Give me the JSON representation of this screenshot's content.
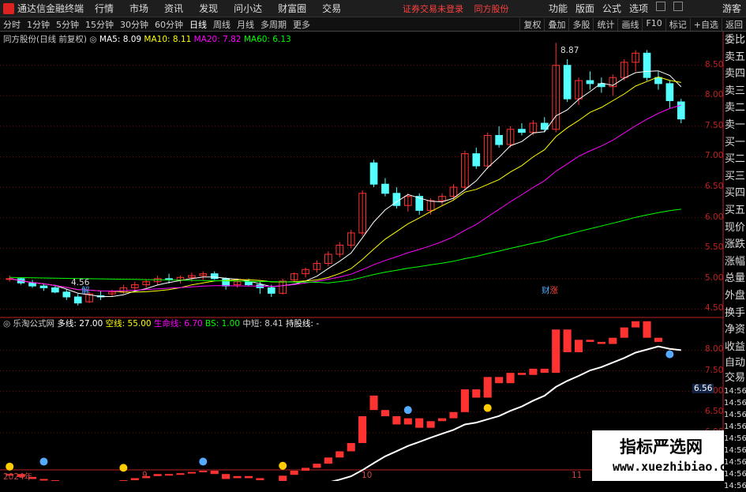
{
  "app": {
    "title": "通达信金融终端",
    "menus": [
      "行情",
      "市场",
      "资讯",
      "发现",
      "问小达",
      "财富圈",
      "交易"
    ],
    "warning": "证券交易未登录",
    "stock_label": "同方股份",
    "right_menus": [
      "功能",
      "版面",
      "公式",
      "选项"
    ],
    "guest": "游客"
  },
  "periods": [
    "分时",
    "1分钟",
    "5分钟",
    "15分钟",
    "30分钟",
    "60分钟",
    "日线",
    "周线",
    "月线",
    "多周期",
    "更多"
  ],
  "active_period": "日线",
  "toolbar": [
    "复权",
    "叠加",
    "多股",
    "统计",
    "画线",
    "F10",
    "标记",
    "+自选",
    "返回"
  ],
  "main_legend": {
    "name": "同方股份(日线 前复权)",
    "ma5": "MA5: 8.09",
    "ma10": "MA10: 8.11",
    "ma20": "MA20: 7.82",
    "ma60": "MA60: 6.13"
  },
  "sub_legend": {
    "name": "乐淘公式网",
    "items": [
      "多线: 27.00",
      "空线: 55.00",
      "生命线: 6.70",
      "BS: 1.00",
      "中短: 8.41",
      "持股线: -"
    ]
  },
  "right_panel": [
    "委比",
    "卖五",
    "卖四",
    "卖三",
    "卖二",
    "卖一",
    "买一",
    "买二",
    "买三",
    "买四",
    "买五",
    "现价",
    "涨跌",
    "涨幅",
    "总量",
    "外盘",
    "换手",
    "净资",
    "收益"
  ],
  "right_panel2": [
    "自动",
    "交易"
  ],
  "price_axis": [
    "8.50",
    "8.00",
    "7.50",
    "7.00",
    "6.50",
    "6.00",
    "5.50",
    "5.00",
    "4.50"
  ],
  "sub_axis": [
    "8.00",
    "7.50",
    "7.00",
    "6.50",
    "6.00"
  ],
  "sub_axis_current": "6.56",
  "time_axis": [
    "2024年",
    "9",
    "10",
    "11"
  ],
  "annotations": {
    "high": "8.87",
    "low": "4.56",
    "marker1": "解",
    "marker2": "财",
    "marker3": "涨"
  },
  "time_ticks": [
    "14:56",
    "14:56",
    "14:56",
    "14:56",
    "14:56",
    "14:56",
    "14:56",
    "14:56",
    "14:56"
  ],
  "watermark": {
    "line1": "指标严选网",
    "line2": "www.xuezhibiao.com"
  },
  "chart_data": {
    "type": "candlestick",
    "ylim": [
      4.35,
      8.95
    ],
    "candles": [
      [
        5.0,
        5.05,
        4.95,
        5.0
      ],
      [
        5.0,
        5.02,
        4.9,
        4.93
      ],
      [
        4.93,
        4.98,
        4.85,
        4.88
      ],
      [
        4.88,
        4.92,
        4.8,
        4.85
      ],
      [
        4.85,
        4.9,
        4.76,
        4.78
      ],
      [
        4.78,
        4.82,
        4.65,
        4.7
      ],
      [
        4.7,
        4.75,
        4.56,
        4.6
      ],
      [
        4.62,
        4.78,
        4.6,
        4.75
      ],
      [
        4.72,
        4.8,
        4.65,
        4.7
      ],
      [
        4.75,
        4.82,
        4.7,
        4.78
      ],
      [
        4.78,
        4.9,
        4.75,
        4.85
      ],
      [
        4.85,
        4.95,
        4.8,
        4.9
      ],
      [
        4.9,
        4.98,
        4.85,
        4.95
      ],
      [
        4.95,
        5.05,
        4.9,
        5.0
      ],
      [
        5.0,
        5.08,
        4.92,
        4.98
      ],
      [
        4.98,
        5.05,
        4.92,
        5.02
      ],
      [
        5.02,
        5.1,
        4.95,
        5.05
      ],
      [
        5.05,
        5.12,
        4.98,
        5.08
      ],
      [
        5.08,
        5.12,
        4.98,
        5.0
      ],
      [
        5.0,
        5.02,
        4.82,
        4.88
      ],
      [
        4.9,
        4.98,
        4.85,
        4.95
      ],
      [
        4.95,
        5.0,
        4.88,
        4.9
      ],
      [
        4.9,
        4.95,
        4.75,
        4.85
      ],
      [
        4.85,
        4.9,
        4.7,
        4.76
      ],
      [
        4.76,
        5.0,
        4.74,
        4.96
      ],
      [
        4.98,
        5.1,
        4.95,
        5.08
      ],
      [
        5.08,
        5.18,
        5.02,
        5.15
      ],
      [
        5.15,
        5.3,
        5.1,
        5.25
      ],
      [
        5.25,
        5.45,
        5.2,
        5.4
      ],
      [
        5.4,
        5.6,
        5.35,
        5.55
      ],
      [
        5.55,
        5.8,
        5.5,
        5.75
      ],
      [
        5.75,
        6.45,
        5.7,
        6.4
      ],
      [
        6.9,
        6.95,
        6.5,
        6.55
      ],
      [
        6.55,
        6.65,
        6.35,
        6.4
      ],
      [
        6.4,
        6.5,
        6.15,
        6.2
      ],
      [
        6.2,
        6.4,
        6.1,
        6.35
      ],
      [
        6.35,
        6.4,
        6.05,
        6.12
      ],
      [
        6.12,
        6.32,
        6.05,
        6.28
      ],
      [
        6.28,
        6.4,
        6.2,
        6.35
      ],
      [
        6.35,
        6.55,
        6.3,
        6.5
      ],
      [
        6.5,
        7.1,
        6.45,
        7.05
      ],
      [
        7.05,
        7.15,
        6.8,
        6.85
      ],
      [
        6.85,
        7.4,
        6.8,
        7.35
      ],
      [
        7.35,
        7.5,
        7.15,
        7.2
      ],
      [
        7.2,
        7.5,
        7.15,
        7.45
      ],
      [
        7.45,
        7.55,
        7.35,
        7.4
      ],
      [
        7.4,
        7.6,
        7.35,
        7.55
      ],
      [
        7.55,
        7.65,
        7.4,
        7.45
      ],
      [
        7.45,
        8.87,
        7.4,
        8.5
      ],
      [
        8.5,
        8.6,
        7.9,
        7.95
      ],
      [
        7.95,
        8.3,
        7.85,
        8.25
      ],
      [
        8.25,
        8.4,
        8.1,
        8.2
      ],
      [
        8.2,
        8.3,
        8.05,
        8.15
      ],
      [
        8.15,
        8.35,
        8.0,
        8.3
      ],
      [
        8.3,
        8.6,
        8.25,
        8.55
      ],
      [
        8.55,
        8.75,
        8.4,
        8.7
      ],
      [
        8.7,
        8.75,
        8.25,
        8.3
      ],
      [
        8.3,
        8.4,
        8.1,
        8.2
      ],
      [
        8.2,
        8.25,
        7.8,
        7.92
      ],
      [
        7.9,
        7.95,
        7.55,
        7.62
      ]
    ]
  },
  "colors": {
    "up": "#ff3232",
    "down": "#54ffff",
    "ma5": "#ffffff",
    "ma10": "#ffff00",
    "ma20": "#ff00ff",
    "ma60": "#00ff00",
    "grid": "#7a1010"
  }
}
